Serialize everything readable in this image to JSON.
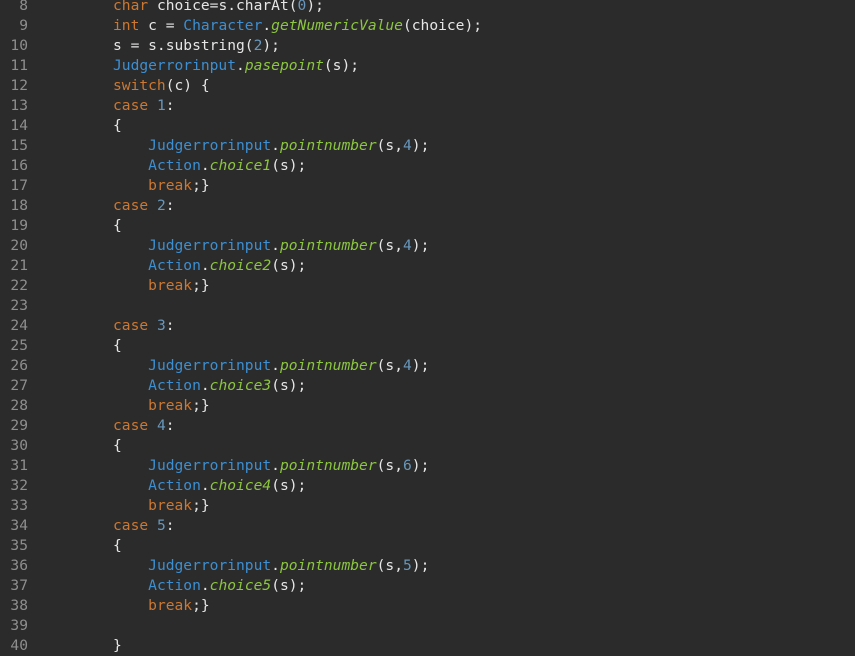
{
  "colors": {
    "background": "#2b2b2b",
    "line_number": "#8e8e8e",
    "plain": "#e6e6e6",
    "keyword": "#cc7832",
    "type": "#3d8fd1",
    "method": "#8cc63f",
    "number": "#6897bb"
  },
  "editor": {
    "lines": [
      {
        "num": "8",
        "tokens": [
          [
            "kw",
            "char"
          ],
          [
            "plain",
            " choice=s.charAt("
          ],
          [
            "num",
            "0"
          ],
          [
            "plain",
            ");"
          ]
        ]
      },
      {
        "num": "9",
        "tokens": [
          [
            "kw",
            "int"
          ],
          [
            "plain",
            " c = "
          ],
          [
            "type",
            "Character"
          ],
          [
            "plain",
            "."
          ],
          [
            "method",
            "getNumericValue"
          ],
          [
            "plain",
            "(choice);"
          ]
        ]
      },
      {
        "num": "10",
        "tokens": [
          [
            "plain",
            "s = s.substring("
          ],
          [
            "num",
            "2"
          ],
          [
            "plain",
            ");"
          ]
        ]
      },
      {
        "num": "11",
        "tokens": [
          [
            "type",
            "Judgerrorinput"
          ],
          [
            "plain",
            "."
          ],
          [
            "method",
            "pasepoint"
          ],
          [
            "plain",
            "(s);"
          ]
        ]
      },
      {
        "num": "12",
        "tokens": [
          [
            "kw",
            "switch"
          ],
          [
            "plain",
            "(c) {"
          ]
        ]
      },
      {
        "num": "13",
        "tokens": [
          [
            "kw",
            "case"
          ],
          [
            "plain",
            " "
          ],
          [
            "num",
            "1"
          ],
          [
            "plain",
            ":"
          ]
        ]
      },
      {
        "num": "14",
        "tokens": [
          [
            "plain",
            "{"
          ]
        ]
      },
      {
        "num": "15",
        "tokens": [
          [
            "plain",
            "    "
          ],
          [
            "type",
            "Judgerrorinput"
          ],
          [
            "plain",
            "."
          ],
          [
            "method",
            "pointnumber"
          ],
          [
            "plain",
            "(s,"
          ],
          [
            "num",
            "4"
          ],
          [
            "plain",
            ");"
          ]
        ]
      },
      {
        "num": "16",
        "tokens": [
          [
            "plain",
            "    "
          ],
          [
            "type",
            "Action"
          ],
          [
            "plain",
            "."
          ],
          [
            "method",
            "choice1"
          ],
          [
            "plain",
            "(s);"
          ]
        ]
      },
      {
        "num": "17",
        "tokens": [
          [
            "plain",
            "    "
          ],
          [
            "kw",
            "break"
          ],
          [
            "plain",
            ";}"
          ]
        ]
      },
      {
        "num": "18",
        "tokens": [
          [
            "kw",
            "case"
          ],
          [
            "plain",
            " "
          ],
          [
            "num",
            "2"
          ],
          [
            "plain",
            ":"
          ]
        ]
      },
      {
        "num": "19",
        "tokens": [
          [
            "plain",
            "{"
          ]
        ]
      },
      {
        "num": "20",
        "tokens": [
          [
            "plain",
            "    "
          ],
          [
            "type",
            "Judgerrorinput"
          ],
          [
            "plain",
            "."
          ],
          [
            "method",
            "pointnumber"
          ],
          [
            "plain",
            "(s,"
          ],
          [
            "num",
            "4"
          ],
          [
            "plain",
            ");"
          ]
        ]
      },
      {
        "num": "21",
        "tokens": [
          [
            "plain",
            "    "
          ],
          [
            "type",
            "Action"
          ],
          [
            "plain",
            "."
          ],
          [
            "method",
            "choice2"
          ],
          [
            "plain",
            "(s);"
          ]
        ]
      },
      {
        "num": "22",
        "tokens": [
          [
            "plain",
            "    "
          ],
          [
            "kw",
            "break"
          ],
          [
            "plain",
            ";}"
          ]
        ]
      },
      {
        "num": "23",
        "tokens": []
      },
      {
        "num": "24",
        "tokens": [
          [
            "kw",
            "case"
          ],
          [
            "plain",
            " "
          ],
          [
            "num",
            "3"
          ],
          [
            "plain",
            ":"
          ]
        ]
      },
      {
        "num": "25",
        "tokens": [
          [
            "plain",
            "{"
          ]
        ]
      },
      {
        "num": "26",
        "tokens": [
          [
            "plain",
            "    "
          ],
          [
            "type",
            "Judgerrorinput"
          ],
          [
            "plain",
            "."
          ],
          [
            "method",
            "pointnumber"
          ],
          [
            "plain",
            "(s,"
          ],
          [
            "num",
            "4"
          ],
          [
            "plain",
            ");"
          ]
        ]
      },
      {
        "num": "27",
        "tokens": [
          [
            "plain",
            "    "
          ],
          [
            "type",
            "Action"
          ],
          [
            "plain",
            "."
          ],
          [
            "method",
            "choice3"
          ],
          [
            "plain",
            "(s);"
          ]
        ]
      },
      {
        "num": "28",
        "tokens": [
          [
            "plain",
            "    "
          ],
          [
            "kw",
            "break"
          ],
          [
            "plain",
            ";}"
          ]
        ]
      },
      {
        "num": "29",
        "tokens": [
          [
            "kw",
            "case"
          ],
          [
            "plain",
            " "
          ],
          [
            "num",
            "4"
          ],
          [
            "plain",
            ":"
          ]
        ]
      },
      {
        "num": "30",
        "tokens": [
          [
            "plain",
            "{"
          ]
        ]
      },
      {
        "num": "31",
        "tokens": [
          [
            "plain",
            "    "
          ],
          [
            "type",
            "Judgerrorinput"
          ],
          [
            "plain",
            "."
          ],
          [
            "method",
            "pointnumber"
          ],
          [
            "plain",
            "(s,"
          ],
          [
            "num",
            "6"
          ],
          [
            "plain",
            ");"
          ]
        ]
      },
      {
        "num": "32",
        "tokens": [
          [
            "plain",
            "    "
          ],
          [
            "type",
            "Action"
          ],
          [
            "plain",
            "."
          ],
          [
            "method",
            "choice4"
          ],
          [
            "plain",
            "(s);"
          ]
        ]
      },
      {
        "num": "33",
        "tokens": [
          [
            "plain",
            "    "
          ],
          [
            "kw",
            "break"
          ],
          [
            "plain",
            ";}"
          ]
        ]
      },
      {
        "num": "34",
        "tokens": [
          [
            "kw",
            "case"
          ],
          [
            "plain",
            " "
          ],
          [
            "num",
            "5"
          ],
          [
            "plain",
            ":"
          ]
        ]
      },
      {
        "num": "35",
        "tokens": [
          [
            "plain",
            "{"
          ]
        ]
      },
      {
        "num": "36",
        "tokens": [
          [
            "plain",
            "    "
          ],
          [
            "type",
            "Judgerrorinput"
          ],
          [
            "plain",
            "."
          ],
          [
            "method",
            "pointnumber"
          ],
          [
            "plain",
            "(s,"
          ],
          [
            "num",
            "5"
          ],
          [
            "plain",
            ");"
          ]
        ]
      },
      {
        "num": "37",
        "tokens": [
          [
            "plain",
            "    "
          ],
          [
            "type",
            "Action"
          ],
          [
            "plain",
            "."
          ],
          [
            "method",
            "choice5"
          ],
          [
            "plain",
            "(s);"
          ]
        ]
      },
      {
        "num": "38",
        "tokens": [
          [
            "plain",
            "    "
          ],
          [
            "kw",
            "break"
          ],
          [
            "plain",
            ";}"
          ]
        ]
      },
      {
        "num": "39",
        "tokens": []
      },
      {
        "num": "40",
        "tokens": [
          [
            "plain",
            "}"
          ]
        ]
      }
    ]
  }
}
